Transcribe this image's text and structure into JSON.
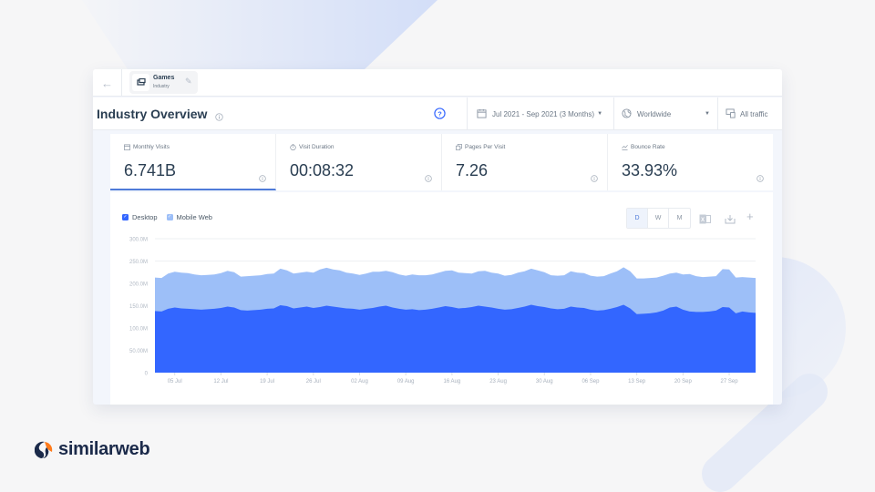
{
  "topbar": {
    "back_icon": "arrow-left-icon",
    "chip": {
      "title": "Games",
      "subtitle": "Industry",
      "icon": "gamepad-icon",
      "edit_icon": "pencil-icon"
    }
  },
  "header": {
    "title": "Industry Overview",
    "date_range": "Jul 2021 - Sep 2021 (3 Months)",
    "country": "Worldwide",
    "traffic": "All traffic"
  },
  "metrics": [
    {
      "label": "Monthly Visits",
      "value": "6.741B",
      "icon": "calendar-icon",
      "active": true
    },
    {
      "label": "Visit Duration",
      "value": "00:08:32",
      "icon": "stopwatch-icon",
      "active": false
    },
    {
      "label": "Pages Per Visit",
      "value": "7.26",
      "icon": "pages-icon",
      "active": false
    },
    {
      "label": "Bounce Rate",
      "value": "33.93%",
      "icon": "bounce-icon",
      "active": false
    }
  ],
  "chart_controls": {
    "granularity": [
      "D",
      "W",
      "M"
    ],
    "selected": "D"
  },
  "colors": {
    "desktop": "#3366ff",
    "mobile_web": "#9dbff8",
    "accent": "#4f7bd9"
  },
  "brand": {
    "name": "similarweb"
  },
  "chart_data": {
    "type": "area",
    "stacked": true,
    "title": "",
    "xlabel": "",
    "ylabel": "",
    "ylim": [
      0,
      300
    ],
    "y_unit": "M",
    "y_ticks": [
      "0",
      "50.00M",
      "100.0M",
      "150.0M",
      "200.0M",
      "250.0M",
      "300.0M"
    ],
    "y_tick_values": [
      0,
      50,
      100,
      150,
      200,
      250,
      300
    ],
    "x_start": "2021-07-02",
    "x_ticks": [
      "05 Jul",
      "12 Jul",
      "19 Jul",
      "26 Jul",
      "02 Aug",
      "09 Aug",
      "16 Aug",
      "23 Aug",
      "30 Aug",
      "06 Sep",
      "13 Sep",
      "20 Sep",
      "27 Sep"
    ],
    "x_tick_day_index": [
      3,
      10,
      17,
      24,
      31,
      38,
      45,
      52,
      59,
      66,
      73,
      80,
      87
    ],
    "grid": true,
    "legend": "top-left",
    "series": [
      {
        "name": "Desktop",
        "values": [
          138,
          137,
          143,
          146,
          144,
          143,
          142,
          141,
          142,
          143,
          145,
          148,
          146,
          140,
          139,
          140,
          141,
          143,
          144,
          151,
          149,
          144,
          146,
          148,
          145,
          147,
          150,
          148,
          146,
          144,
          143,
          141,
          143,
          145,
          148,
          150,
          146,
          143,
          141,
          142,
          140,
          141,
          143,
          146,
          149,
          147,
          144,
          145,
          147,
          150,
          148,
          146,
          143,
          141,
          142,
          145,
          148,
          152,
          149,
          147,
          144,
          142,
          143,
          148,
          146,
          145,
          141,
          139,
          140,
          143,
          147,
          152,
          144,
          131,
          132,
          133,
          135,
          139,
          146,
          148,
          141,
          137,
          136,
          136,
          137,
          139,
          147,
          146,
          133,
          137,
          135,
          134
        ]
      },
      {
        "name": "Mobile Web",
        "values": [
          75,
          75,
          79,
          80,
          80,
          80,
          78,
          77,
          77,
          77,
          78,
          80,
          79,
          75,
          77,
          77,
          77,
          78,
          78,
          82,
          80,
          78,
          78,
          78,
          79,
          84,
          85,
          83,
          83,
          80,
          79,
          78,
          79,
          81,
          78,
          78,
          79,
          77,
          76,
          78,
          78,
          77,
          77,
          78,
          79,
          82,
          80,
          78,
          75,
          77,
          80,
          78,
          79,
          76,
          77,
          79,
          79,
          81,
          80,
          78,
          74,
          75,
          75,
          79,
          78,
          78,
          76,
          76,
          76,
          79,
          80,
          84,
          83,
          80,
          79,
          79,
          78,
          78,
          76,
          76,
          79,
          84,
          80,
          78,
          78,
          77,
          85,
          85,
          80,
          77,
          78,
          78
        ]
      }
    ]
  }
}
